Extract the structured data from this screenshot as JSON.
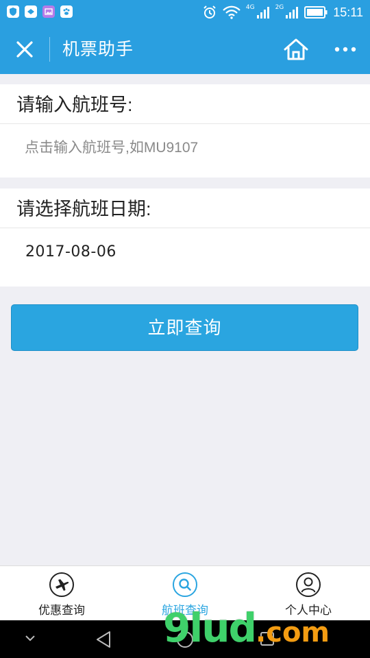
{
  "status_bar": {
    "time": "15:11",
    "network_4g": "4G",
    "network_2g": "2G"
  },
  "title_bar": {
    "title": "机票助手"
  },
  "flight_number": {
    "label": "请输入航班号:",
    "placeholder": "点击输入航班号,如MU9107",
    "value": ""
  },
  "flight_date": {
    "label": "请选择航班日期:",
    "value": "2017-08-06"
  },
  "query_button": {
    "label": "立即查询"
  },
  "tab_bar": {
    "active_color": "#2aa5e0",
    "tabs": [
      {
        "label": "优惠查询",
        "icon": "airplane-icon"
      },
      {
        "label": "航班查询",
        "icon": "search-icon"
      },
      {
        "label": "个人中心",
        "icon": "user-icon"
      }
    ]
  },
  "watermark": {
    "main": "9lud",
    "suffix": ".com"
  },
  "colors": {
    "brand_blue": "#2a9fe0",
    "page_bg": "#efeff4"
  }
}
